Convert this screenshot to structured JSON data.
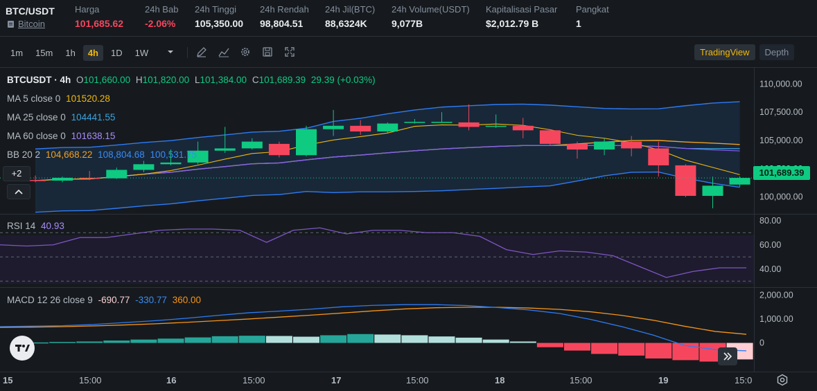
{
  "header": {
    "symbol": "BTC/USDT",
    "asset_name": "Bitcoin",
    "stats": [
      {
        "label": "Harga",
        "value": "101,685.62",
        "color": "#f6465d"
      },
      {
        "label": "24h Bab",
        "value": "-2.06%",
        "color": "#f6465d"
      },
      {
        "label": "24h Tinggi",
        "value": "105,350.00",
        "color": "#eaecef"
      },
      {
        "label": "24h Rendah",
        "value": "98,804.51",
        "color": "#eaecef"
      },
      {
        "label": "24h Jil(BTC)",
        "value": "88,6324K",
        "color": "#eaecef"
      },
      {
        "label": "24h Volume(USDT)",
        "value": "9,077B",
        "color": "#eaecef"
      },
      {
        "label": "Kapitalisasi Pasar",
        "value": "$2,012.79 B",
        "color": "#eaecef"
      },
      {
        "label": "Pangkat",
        "value": "1",
        "color": "#eaecef"
      }
    ]
  },
  "toolbar": {
    "timeframes": [
      "1m",
      "15m",
      "1h",
      "4h",
      "1D",
      "1W"
    ],
    "active_timeframe": "4h",
    "icons": [
      "chevron-down-icon",
      "draw-icon",
      "indicator-icon",
      "settings-icon",
      "save-icon",
      "fullscreen-icon"
    ],
    "views": [
      "TradingView",
      "Depth"
    ],
    "active_view": "TradingView"
  },
  "legend": {
    "title": "BTCUSDT · 4h",
    "open_label": "O",
    "open": "101,660.00",
    "high_label": "H",
    "high": "101,820.00",
    "low_label": "L",
    "low": "101,384.00",
    "close_label": "C",
    "close": "101,689.39",
    "change": "29.39 (+0.03%)",
    "ma5_label": "MA 5 close 0",
    "ma5": "101520.28",
    "ma25_label": "MA 25 close 0",
    "ma25": "104441.55",
    "ma60_label": "MA 60 close 0",
    "ma60": "101638.15",
    "bb_label": "BB 20 2",
    "bb_mid": "104,668.22",
    "bb_up": "108,804.68",
    "bb_low": "100,531.75",
    "more_count": "+2",
    "rsi_label": "RSI 14",
    "rsi": "40.93",
    "macd_label": "MACD 12 26 close 9",
    "macd_hist": "-690.77",
    "macd_line": "-330.77",
    "macd_signal": "360.00"
  },
  "colors": {
    "up": "#0ecb81",
    "down": "#f6465d",
    "ma5": "#f0b90b",
    "ma25": "#3aa3e0",
    "ma60": "#8b5cf6",
    "bb": "#2f7bf5",
    "bb_mid": "#f0a020",
    "rsi": "#7e57c2",
    "macd": "#2f7bf5",
    "signal": "#f7931a"
  },
  "price_axis": [
    "110,000.00",
    "107,500.00",
    "105,000.00",
    "102,500.00",
    "100,000.00"
  ],
  "current_price": "101,689.39",
  "rsi_axis": [
    "80.00",
    "60.00",
    "40.00"
  ],
  "macd_axis": [
    "2,000.00",
    "1,000.00",
    "0"
  ],
  "time_axis": [
    "15",
    "15:00",
    "16",
    "15:00",
    "17",
    "15:00",
    "18",
    "15:00",
    "19",
    "15:0"
  ],
  "chart_data": [
    {
      "type": "candlestick",
      "title": "BTCUSDT · 4h",
      "ylim": [
        99000,
        111000
      ],
      "candles": [
        {
          "o": 101500,
          "h": 101900,
          "l": 101300,
          "c": 101450
        },
        {
          "o": 101450,
          "h": 101800,
          "l": 101300,
          "c": 101700
        },
        {
          "o": 101700,
          "h": 102300,
          "l": 101500,
          "c": 101650
        },
        {
          "o": 101650,
          "h": 102600,
          "l": 101600,
          "c": 102400
        },
        {
          "o": 102400,
          "h": 103200,
          "l": 102200,
          "c": 102900
        },
        {
          "o": 102900,
          "h": 104200,
          "l": 102800,
          "c": 103050
        },
        {
          "o": 103050,
          "h": 104900,
          "l": 102900,
          "c": 104100
        },
        {
          "o": 104100,
          "h": 106200,
          "l": 103900,
          "c": 104300
        },
        {
          "o": 104300,
          "h": 105200,
          "l": 104200,
          "c": 104900
        },
        {
          "o": 104700,
          "h": 104900,
          "l": 103500,
          "c": 103700
        },
        {
          "o": 103700,
          "h": 106300,
          "l": 103600,
          "c": 106000
        },
        {
          "o": 106000,
          "h": 107700,
          "l": 105400,
          "c": 106300
        },
        {
          "o": 106300,
          "h": 106800,
          "l": 105500,
          "c": 105800
        },
        {
          "o": 105800,
          "h": 106600,
          "l": 105600,
          "c": 106500
        },
        {
          "o": 106600,
          "h": 106900,
          "l": 106500,
          "c": 106650
        },
        {
          "o": 106650,
          "h": 107500,
          "l": 106600,
          "c": 106650
        },
        {
          "o": 106600,
          "h": 108200,
          "l": 105900,
          "c": 106200
        },
        {
          "o": 106300,
          "h": 107300,
          "l": 106100,
          "c": 106300
        },
        {
          "o": 106300,
          "h": 107000,
          "l": 105200,
          "c": 105900
        },
        {
          "o": 105900,
          "h": 106000,
          "l": 104600,
          "c": 104700
        },
        {
          "o": 104700,
          "h": 104900,
          "l": 103400,
          "c": 104200
        },
        {
          "o": 104200,
          "h": 105200,
          "l": 103700,
          "c": 104900
        },
        {
          "o": 104900,
          "h": 105400,
          "l": 103600,
          "c": 104300
        },
        {
          "o": 104300,
          "h": 104900,
          "l": 101800,
          "c": 102800
        },
        {
          "o": 102800,
          "h": 102900,
          "l": 100000,
          "c": 100100
        },
        {
          "o": 100100,
          "h": 101800,
          "l": 99000,
          "c": 101000
        },
        {
          "o": 101100,
          "h": 101820,
          "l": 100900,
          "c": 101689
        }
      ]
    },
    {
      "type": "line",
      "title": "RSI 14",
      "ylim": [
        25,
        85
      ],
      "values": [
        60,
        59,
        60,
        66,
        66,
        69,
        72,
        73,
        73,
        72,
        62,
        72,
        74,
        69,
        72,
        72,
        70,
        70,
        67,
        56,
        52,
        55,
        54,
        51,
        42,
        33,
        38,
        41,
        41
      ]
    },
    {
      "type": "bar",
      "title": "MACD 12 26 close 9",
      "ylim": [
        -1200,
        2300
      ],
      "histogram": [
        20,
        40,
        60,
        100,
        140,
        180,
        230,
        280,
        300,
        290,
        260,
        320,
        370,
        350,
        320,
        270,
        220,
        140,
        60,
        -180,
        -320,
        -460,
        -530,
        -650,
        -720,
        -780,
        -690
      ],
      "macd": [
        680,
        700,
        720,
        770,
        850,
        930,
        1030,
        1150,
        1260,
        1330,
        1410,
        1510,
        1570,
        1600,
        1600,
        1560,
        1480,
        1380,
        1230,
        980,
        680,
        330,
        -100,
        -280,
        -330
      ],
      "signal": [
        650,
        660,
        680,
        710,
        750,
        800,
        860,
        930,
        1000,
        1080,
        1160,
        1250,
        1340,
        1420,
        1470,
        1490,
        1490,
        1460,
        1400,
        1300,
        1150,
        950,
        700,
        480,
        360
      ]
    }
  ]
}
